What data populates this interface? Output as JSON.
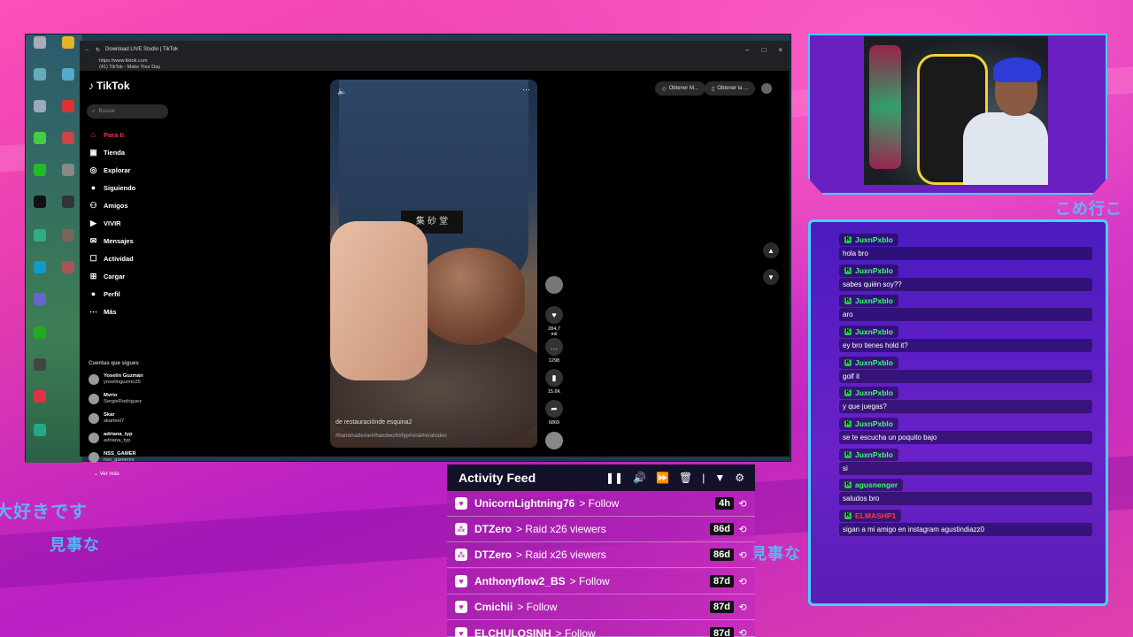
{
  "browser": {
    "tab_title": "Download LIVE Studio | TikTok",
    "address_url": "https://www.tiktok.com",
    "address_subtitle": "(41) TikTok - Make Your Day"
  },
  "tiktok": {
    "logo": "TikTok",
    "search_placeholder": "Buscar",
    "nav": [
      {
        "label": "Para ti",
        "icon": "home-icon"
      },
      {
        "label": "Tienda",
        "icon": "shop-icon"
      },
      {
        "label": "Explorar",
        "icon": "compass-icon"
      },
      {
        "label": "Siguiendo",
        "icon": "following-icon"
      },
      {
        "label": "Amigos",
        "icon": "friends-icon"
      },
      {
        "label": "VIVIR",
        "icon": "live-icon"
      },
      {
        "label": "Mensajes",
        "icon": "messages-icon"
      },
      {
        "label": "Actividad",
        "icon": "activity-icon"
      },
      {
        "label": "Cargar",
        "icon": "upload-icon"
      },
      {
        "label": "Perfil",
        "icon": "profile-icon"
      },
      {
        "label": "Más",
        "icon": "more-icon"
      }
    ],
    "following_header": "Cuentas que sigues",
    "following": [
      {
        "name": "Yoselin Guzmán",
        "handle": "yoselinguzmn25"
      },
      {
        "name": "Mvrio",
        "handle": "SergieRodriguez"
      },
      {
        "name": "Skar",
        "handle": "skarleel7"
      },
      {
        "name": "adriana_typ",
        "handle": "adriana_typ"
      },
      {
        "name": "NSS_GAMER",
        "handle": "nss_gamerxx"
      }
    ],
    "see_more": "Ver más",
    "video": {
      "caption": "de restauraciónde esquina2",
      "hashtags": "#handmade#art#handwork#fyp#viral#viralvideo",
      "patch_text": "集 砂 堂"
    },
    "actions": {
      "likes": "284,7 mil",
      "comments": "1298",
      "saves": "15.6K",
      "shares": "6869"
    },
    "top_pills": [
      "Obtener M...",
      "Obtener la ..."
    ]
  },
  "chat": {
    "messages": [
      {
        "user": "JuxnPxblo",
        "text": "hola bro",
        "color": "#3cff6e"
      },
      {
        "user": "JuxnPxblo",
        "text": "sabes quién soy??",
        "color": "#3cff6e"
      },
      {
        "user": "JuxnPxblo",
        "text": "aro",
        "color": "#3cff6e"
      },
      {
        "user": "JuxnPxblo",
        "text": "ey bro tienes hold it?",
        "color": "#3cff6e"
      },
      {
        "user": "JuxnPxblo",
        "text": "golf it",
        "color": "#3cff6e"
      },
      {
        "user": "JuxnPxblo",
        "text": "y que juegas?",
        "color": "#3cff6e"
      },
      {
        "user": "JuxnPxblo",
        "text": "se te escucha un poquito bajo",
        "color": "#3cff6e"
      },
      {
        "user": "JuxnPxblo",
        "text": "si",
        "color": "#3cff6e"
      },
      {
        "user": "agusnenger",
        "text": "saludos bro",
        "color": "#3cff6e"
      },
      {
        "user": "ELMASHP1",
        "text": "sigan a mi amigo en instagram agustindiazz0",
        "color": "#ff3a3a"
      }
    ]
  },
  "feed": {
    "title": "Activity Feed",
    "rows": [
      {
        "user": "UnicornLightning76",
        "action": "> Follow",
        "time": "4h",
        "icon": "heart-icon",
        "glyph": "♥"
      },
      {
        "user": "DTZero",
        "action": "> Raid x26 viewers",
        "time": "86d",
        "icon": "raid-icon",
        "glyph": "⁂"
      },
      {
        "user": "DTZero",
        "action": "> Raid x26 viewers",
        "time": "86d",
        "icon": "raid-icon",
        "glyph": "⁂"
      },
      {
        "user": "Anthonyflow2_BS",
        "action": "> Follow",
        "time": "87d",
        "icon": "heart-icon",
        "glyph": "♥"
      },
      {
        "user": "Cmichii",
        "action": "> Follow",
        "time": "87d",
        "icon": "heart-icon",
        "glyph": "♥"
      },
      {
        "user": "ELCHULOSINH",
        "action": "> Follow",
        "time": "87d",
        "icon": "heart-icon",
        "glyph": "♥"
      }
    ]
  },
  "overlay_text": {
    "jp_left_1": "大好きです",
    "jp_left_2": "見事な",
    "jp_right": "見事な",
    "jp_top": "こめ行こ"
  }
}
